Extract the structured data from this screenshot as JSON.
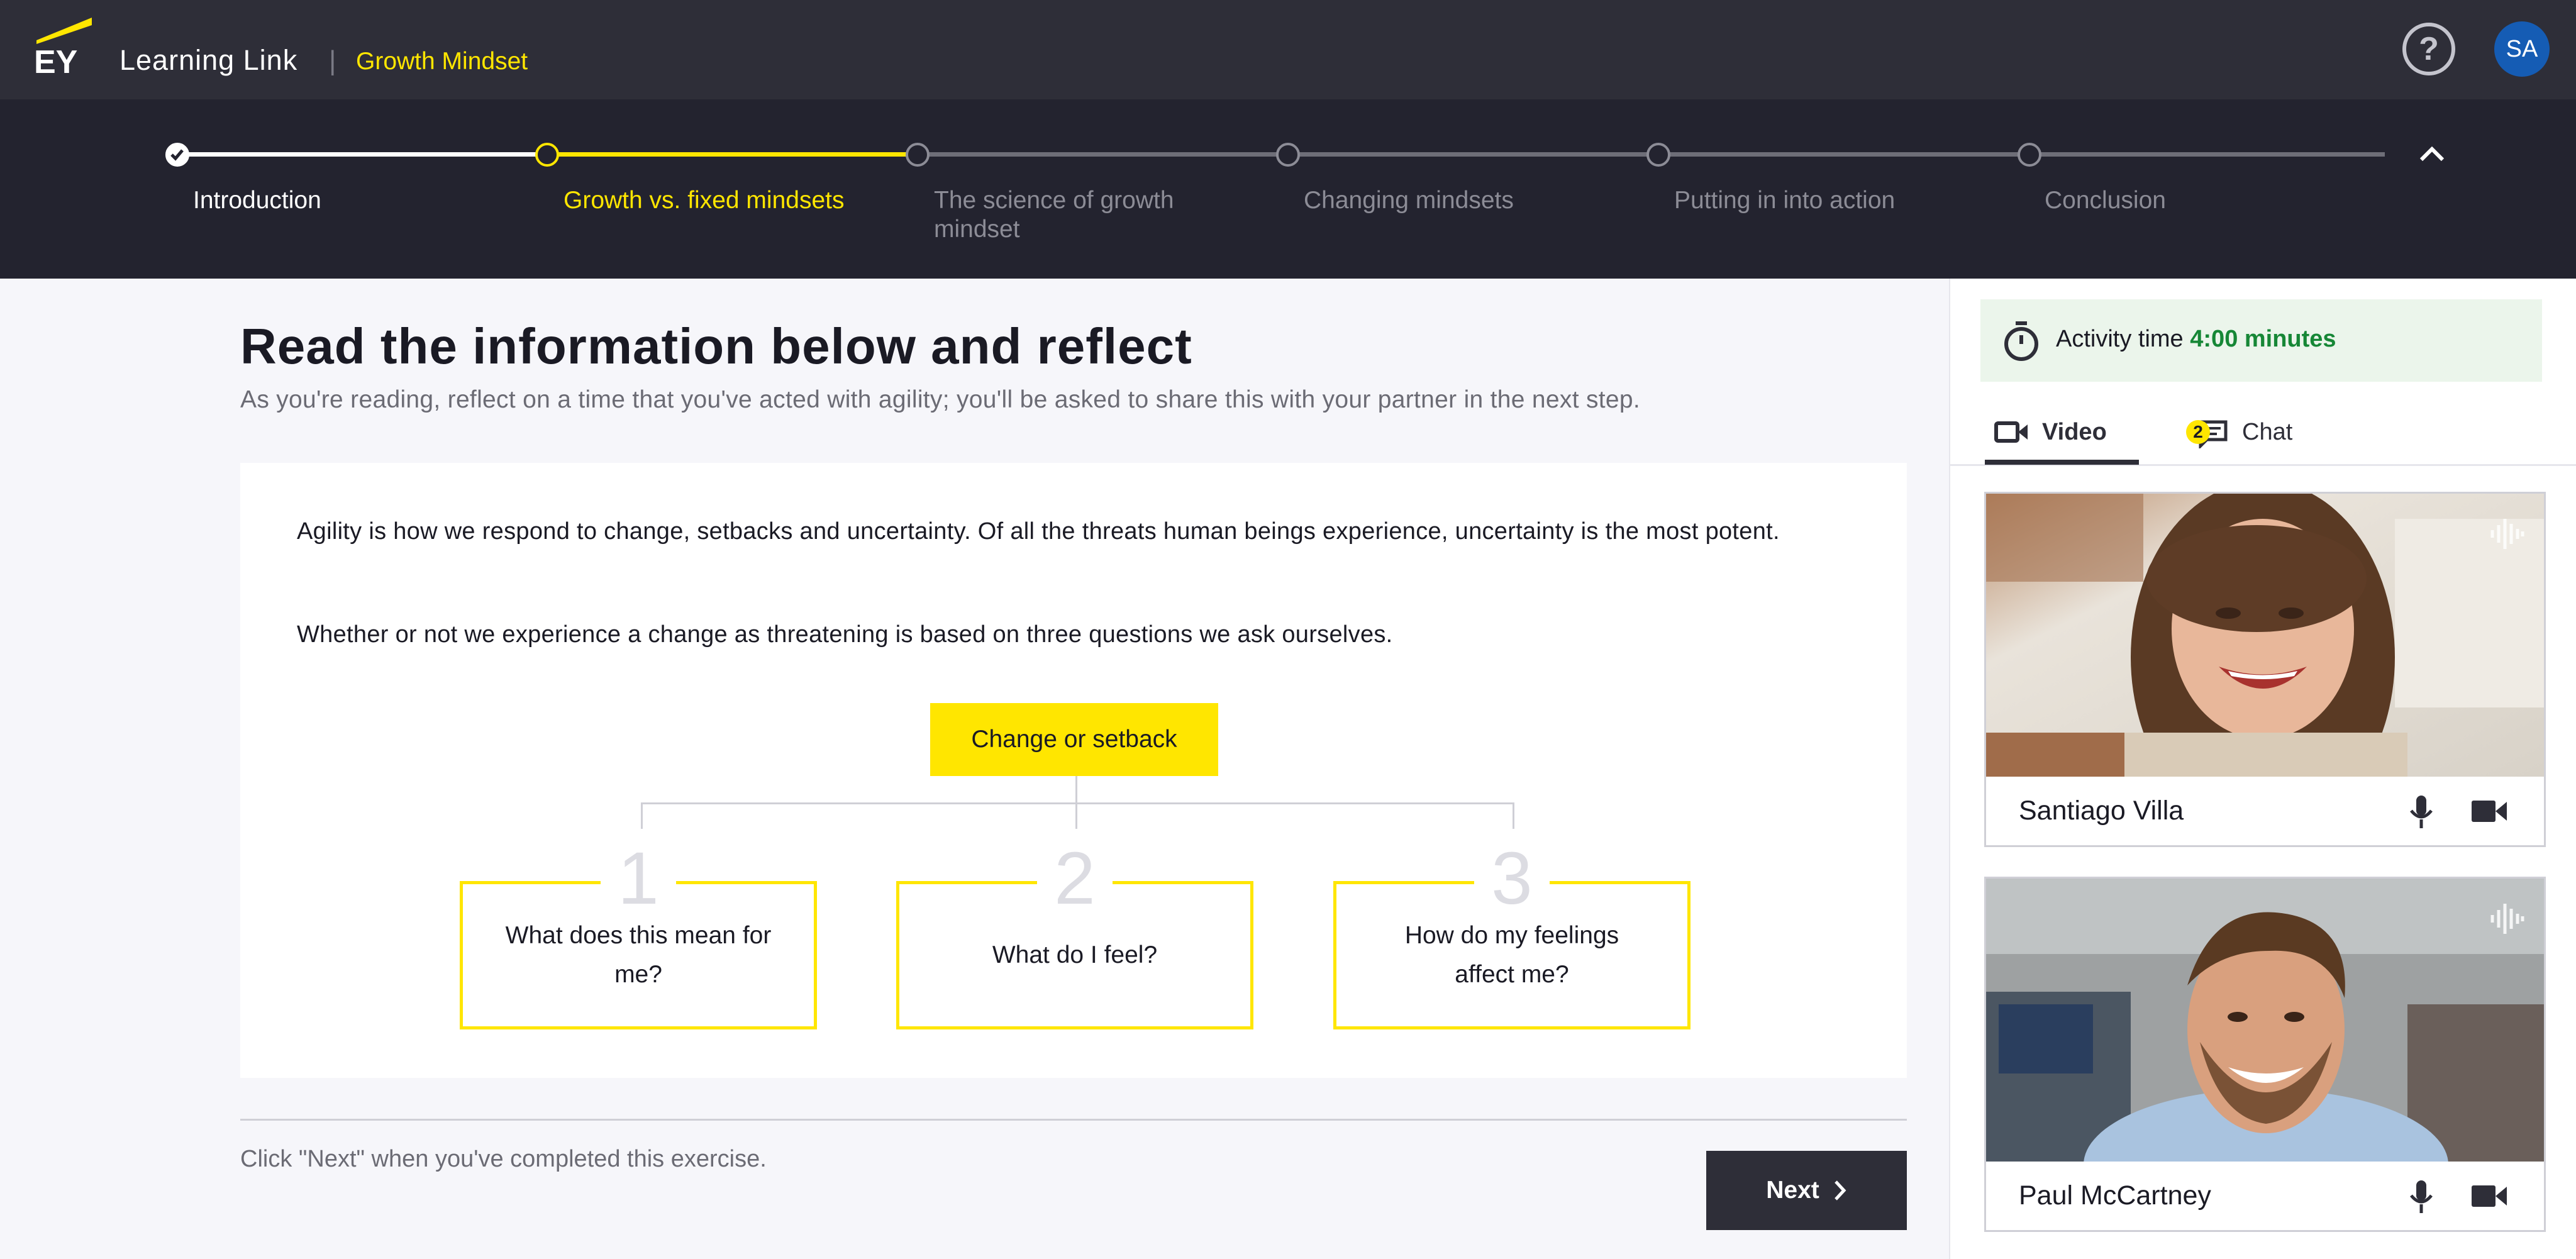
{
  "header": {
    "app_name": "Learning Link",
    "separator": "|",
    "course": "Growth Mindset",
    "help_glyph": "?",
    "user_initials": "SA",
    "accent": "#ffe600",
    "bar_color": "#2e2e38"
  },
  "stepper": {
    "steps": [
      {
        "label": "Introduction",
        "state": "done"
      },
      {
        "label": "Growth vs. fixed mindsets",
        "state": "active"
      },
      {
        "label": "The science of growth mindset",
        "state": "upcoming"
      },
      {
        "label": "Changing mindsets",
        "state": "upcoming"
      },
      {
        "label": "Putting in into action",
        "state": "upcoming"
      },
      {
        "label": "Conclusion",
        "state": "upcoming"
      }
    ]
  },
  "main": {
    "title": "Read the information below and reflect",
    "subtitle": "As you're reading, reflect on a time that you've acted with agility; you'll be asked to share this with your partner in the next step.",
    "paragraph1": "Agility is how we respond to change, setbacks and uncertainty. Of all the threats human beings experience, uncertainty is the most potent.",
    "paragraph2": "Whether or not we experience a change as threatening is based on three questions we ask ourselves.",
    "root_label": "Change or setback",
    "questions": [
      {
        "num": "1",
        "text": "What does this mean for me?"
      },
      {
        "num": "2",
        "text": "What do I feel?"
      },
      {
        "num": "3",
        "text": "How do my feelings affect me?"
      }
    ],
    "footer_note": "Click \"Next\" when you've completed this exercise.",
    "next_label": "Next"
  },
  "side": {
    "activity_label": "Activity time",
    "activity_value": "4:00 minutes",
    "tabs": [
      {
        "label": "Video",
        "icon": "video-camera-icon",
        "active": true
      },
      {
        "label": "Chat",
        "icon": "chat-icon",
        "badge": "2"
      }
    ],
    "participants": [
      {
        "name": "Santiago Villa"
      },
      {
        "name": "Paul McCartney"
      }
    ]
  }
}
